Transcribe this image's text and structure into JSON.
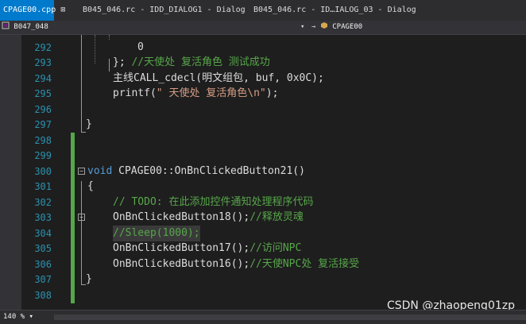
{
  "tabs": [
    {
      "label": "CPAGE00.cpp",
      "close": "⊠"
    },
    {
      "label": "B045_046.rc - IDD_DIALOG1 - Dialog"
    },
    {
      "label": "B045_046.rc - ID…IALOG_03 - Dialog"
    }
  ],
  "navigation": {
    "project_icon": "project-icon",
    "project": "B047_048",
    "scope_icon": "class-icon",
    "scope": "CPAGE00"
  },
  "code_lines": [
    {
      "n": "292",
      "text": "0"
    },
    {
      "n": "293",
      "brace": "}; ",
      "comment": "//天使处 复活角色 测试成功"
    },
    {
      "n": "294",
      "text": "主线CALL_cdecl(明文组包, buf, 0x0C);"
    },
    {
      "n": "295",
      "pre": "printf(",
      "str": "\" 天使处 复活角色\\n\"",
      "post": ");"
    },
    {
      "n": "296",
      "text": ""
    },
    {
      "n": "297",
      "text": "}"
    },
    {
      "n": "298",
      "text": ""
    },
    {
      "n": "299",
      "text": ""
    },
    {
      "n": "300",
      "kw": "void",
      "text": " CPAGE00::OnBnClickedButton21()"
    },
    {
      "n": "301",
      "text": "{"
    },
    {
      "n": "302",
      "comment": "// TODO: 在此添加控件通知处理程序代码"
    },
    {
      "n": "303",
      "text": "OnBnClickedButton18();",
      "comment": "//释放灵魂"
    },
    {
      "n": "304",
      "comment": "//Sleep(1000);"
    },
    {
      "n": "305",
      "text": "OnBnClickedButton17();",
      "comment": "//访问NPC"
    },
    {
      "n": "306",
      "text": "OnBnClickedButton16();",
      "comment": "//天使NPC处 复活接受"
    },
    {
      "n": "307",
      "text": "}"
    },
    {
      "n": "308",
      "text": ""
    }
  ],
  "status": {
    "zoom": "140 %",
    "zoom_arrow": "▾"
  },
  "watermark": "CSDN @zhaopeng01zp",
  "colors": {
    "accent": "#007acc",
    "change_bar": "#57a64a",
    "line_number": "#2b91af",
    "keyword": "#569cd6",
    "comment": "#57a64a",
    "string": "#d69d85"
  }
}
